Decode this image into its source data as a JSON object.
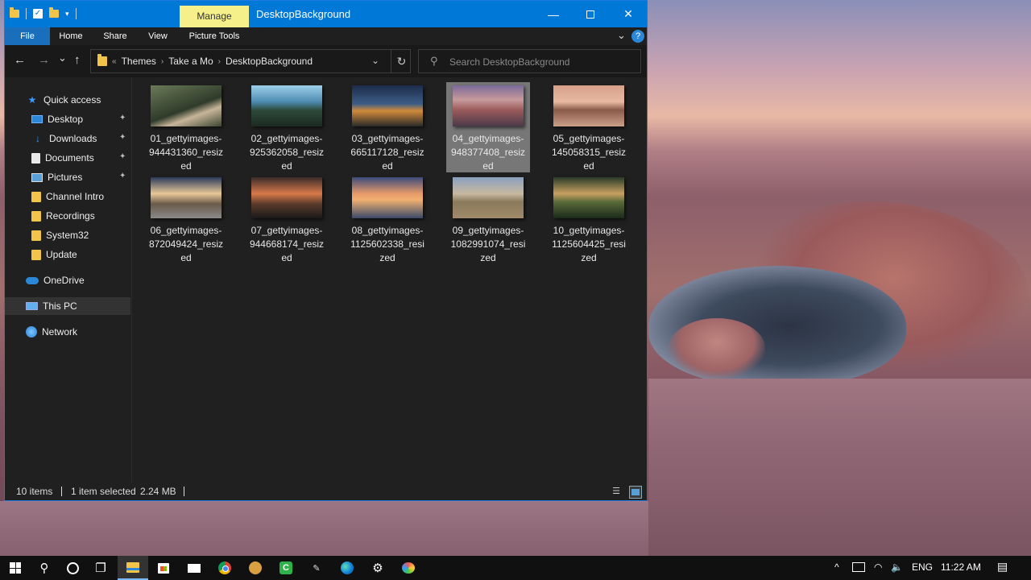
{
  "window": {
    "title": "DesktopBackground",
    "context_tab": "Manage",
    "min_glyph": "—",
    "close_glyph": "✕"
  },
  "ribbon": {
    "tabs": [
      "File",
      "Home",
      "Share",
      "View",
      "Picture Tools"
    ],
    "help": "?"
  },
  "nav": {
    "back": "←",
    "forward": "→",
    "recent": "⌄",
    "up": "↑"
  },
  "address": {
    "lead": "«",
    "crumbs": [
      "Themes",
      "Take a Mo",
      "DesktopBackground"
    ],
    "sep": "›",
    "dropdown": "⌄",
    "refresh": "↻"
  },
  "search": {
    "placeholder": "Search DesktopBackground",
    "icon": "⚲"
  },
  "sidebar": {
    "items": [
      {
        "label": "Quick access",
        "icon": "star-icon",
        "pinned": false
      },
      {
        "label": "Desktop",
        "icon": "desktop-icon",
        "pinned": true
      },
      {
        "label": "Downloads",
        "icon": "download-icon",
        "pinned": true
      },
      {
        "label": "Documents",
        "icon": "documents-icon",
        "pinned": true
      },
      {
        "label": "Pictures",
        "icon": "pictures-icon",
        "pinned": true
      },
      {
        "label": "Channel Intro",
        "icon": "folder-icon",
        "pinned": false
      },
      {
        "label": "Recordings",
        "icon": "folder-icon",
        "pinned": false
      },
      {
        "label": "System32",
        "icon": "folder-icon",
        "pinned": false
      },
      {
        "label": "Update",
        "icon": "folder-icon",
        "pinned": false
      },
      {
        "label": "OneDrive",
        "icon": "onedrive-icon",
        "pinned": false
      },
      {
        "label": "This PC",
        "icon": "this-pc-icon",
        "pinned": false,
        "selected": true
      },
      {
        "label": "Network",
        "icon": "network-icon",
        "pinned": false
      }
    ],
    "pin_glyph": "📌"
  },
  "files": [
    {
      "name": "01_gettyimages-944431360_resized",
      "selected": false
    },
    {
      "name": "02_gettyimages-925362058_resized",
      "selected": false
    },
    {
      "name": "03_gettyimages-665117128_resized",
      "selected": false
    },
    {
      "name": "04_gettyimages-948377408_resized",
      "selected": true
    },
    {
      "name": "05_gettyimages-145058315_resized",
      "selected": false
    },
    {
      "name": "06_gettyimages-872049424_resized",
      "selected": false
    },
    {
      "name": "07_gettyimages-944668174_resized",
      "selected": false
    },
    {
      "name": "08_gettyimages-1125602338_resized",
      "selected": false
    },
    {
      "name": "09_gettyimages-1082991074_resized",
      "selected": false
    },
    {
      "name": "10_gettyimages-1125604425_resized",
      "selected": false
    }
  ],
  "status": {
    "items_count": "10 items",
    "selection": "1 item selected",
    "size": "2.24 MB",
    "details_glyph": "☰"
  },
  "taskbar": {
    "search_glyph": "⚲",
    "taskview_glyph": "❐",
    "settings_glyph": "⚙",
    "tray_chevron": "^",
    "wifi_glyph": "◠",
    "volume_glyph": "🔈",
    "language": "ENG",
    "time": "11:22 AM",
    "notif_glyph": "▤"
  },
  "colors": {
    "accent": "#0078d7",
    "manage_tab": "#f5f08a",
    "window_bg": "#202020",
    "taskbar": "#101010"
  }
}
